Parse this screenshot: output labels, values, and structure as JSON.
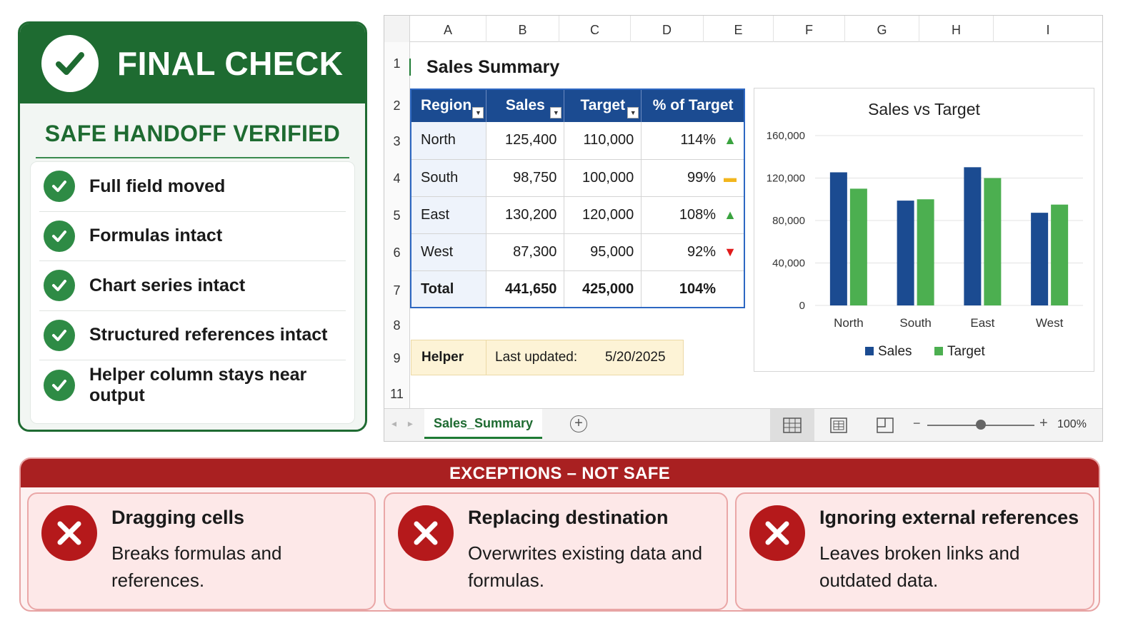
{
  "final_check": {
    "title": "FINAL CHECK",
    "subtitle": "SAFE HANDOFF VERIFIED",
    "items": [
      {
        "label": "Full field moved"
      },
      {
        "label": "Formulas intact"
      },
      {
        "label": "Chart series intact"
      },
      {
        "label": "Structured references intact"
      },
      {
        "label": "Helper column stays near output"
      }
    ],
    "accent_color": "#1e6b31"
  },
  "spreadsheet": {
    "columns": [
      "A",
      "B",
      "C",
      "D",
      "E",
      "F",
      "G",
      "H",
      "I"
    ],
    "rows": [
      "1",
      "2",
      "3",
      "4",
      "5",
      "6",
      "7",
      "8",
      "9",
      "11"
    ],
    "title": "Sales Summary",
    "table": {
      "headers": [
        "Region",
        "Sales",
        "Target",
        "% of Target"
      ],
      "rows": [
        {
          "region": "North",
          "sales": "125,400",
          "target": "110,000",
          "pct": "114%",
          "trend": "up"
        },
        {
          "region": "South",
          "sales": "98,750",
          "target": "100,000",
          "pct": "99%",
          "trend": "flat"
        },
        {
          "region": "East",
          "sales": "130,200",
          "target": "120,000",
          "pct": "108%",
          "trend": "up"
        },
        {
          "region": "West",
          "sales": "87,300",
          "target": "95,000",
          "pct": "92%",
          "trend": "down"
        }
      ],
      "total": {
        "region": "Total",
        "sales": "441,650",
        "target": "425,000",
        "pct": "104%"
      },
      "header_color": "#1b4b91"
    },
    "helper": {
      "label": "Helper",
      "key": "Last updated:",
      "value": "5/20/2025"
    },
    "sheet_tab": "Sales_Summary",
    "zoom": "100%",
    "zoom_fraction": 0.5
  },
  "chart_data": {
    "type": "bar",
    "title": "Sales vs Target",
    "categories": [
      "North",
      "South",
      "East",
      "West"
    ],
    "series": [
      {
        "name": "Sales",
        "values": [
          125400,
          98750,
          130200,
          87300
        ],
        "color": "#1b4b91"
      },
      {
        "name": "Target",
        "values": [
          110000,
          100000,
          120000,
          95000
        ],
        "color": "#4caf50"
      }
    ],
    "ylim": [
      0,
      160000
    ],
    "yticks": [
      0,
      40000,
      80000,
      120000,
      160000
    ],
    "ytick_labels": [
      "0",
      "40,000",
      "80,000",
      "120,000",
      "160,000"
    ],
    "grid": true,
    "legend": "bottom",
    "xlabel": "",
    "ylabel": ""
  },
  "exceptions": {
    "title": "EXCEPTIONS – NOT SAFE",
    "items": [
      {
        "title": "Dragging cells",
        "desc": "Breaks formulas and references."
      },
      {
        "title": "Replacing destination",
        "desc": "Overwrites existing data and formulas."
      },
      {
        "title": "Ignoring external references",
        "desc": "Leaves broken links and outdated data."
      }
    ],
    "accent_color": "#a92021"
  }
}
